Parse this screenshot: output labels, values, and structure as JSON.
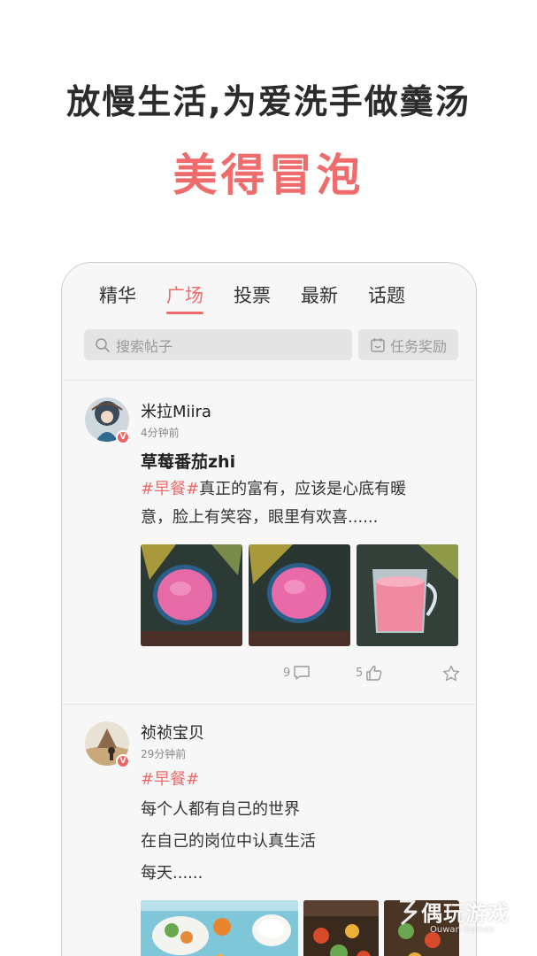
{
  "promo": {
    "headline": "放慢生活,为爱洗手做羹汤",
    "subheadline": "美得冒泡"
  },
  "tabs": [
    {
      "label": "精华",
      "active": false
    },
    {
      "label": "广场",
      "active": true
    },
    {
      "label": "投票",
      "active": false
    },
    {
      "label": "最新",
      "active": false
    },
    {
      "label": "话题",
      "active": false
    }
  ],
  "search": {
    "placeholder": "搜索帖子",
    "task_label": "任务奖励",
    "icon": "search-icon",
    "task_icon": "task-calendar-icon"
  },
  "posts": [
    {
      "username": "米拉Miira",
      "time": "4分钟前",
      "title": "草莓番茄zhi",
      "tag": "#早餐#",
      "text_line1": "真正的富有，应该是心底有暖",
      "text_line2": "意，脸上有笑容，眼里有欢喜......",
      "comments": "9",
      "likes": "5",
      "badge": "V"
    },
    {
      "username": "祯祯宝贝",
      "time": "29分钟前",
      "tag": "#早餐#",
      "lines": [
        "每个人都有自己的世界",
        "在自己的岗位中认真生活",
        "每天......"
      ],
      "badge": "V"
    }
  ],
  "watermark": {
    "main": "偶玩游戏",
    "sub": "Ouwan Games"
  },
  "colors": {
    "accent": "#ef6b6b",
    "background": "#f7f7f7"
  }
}
